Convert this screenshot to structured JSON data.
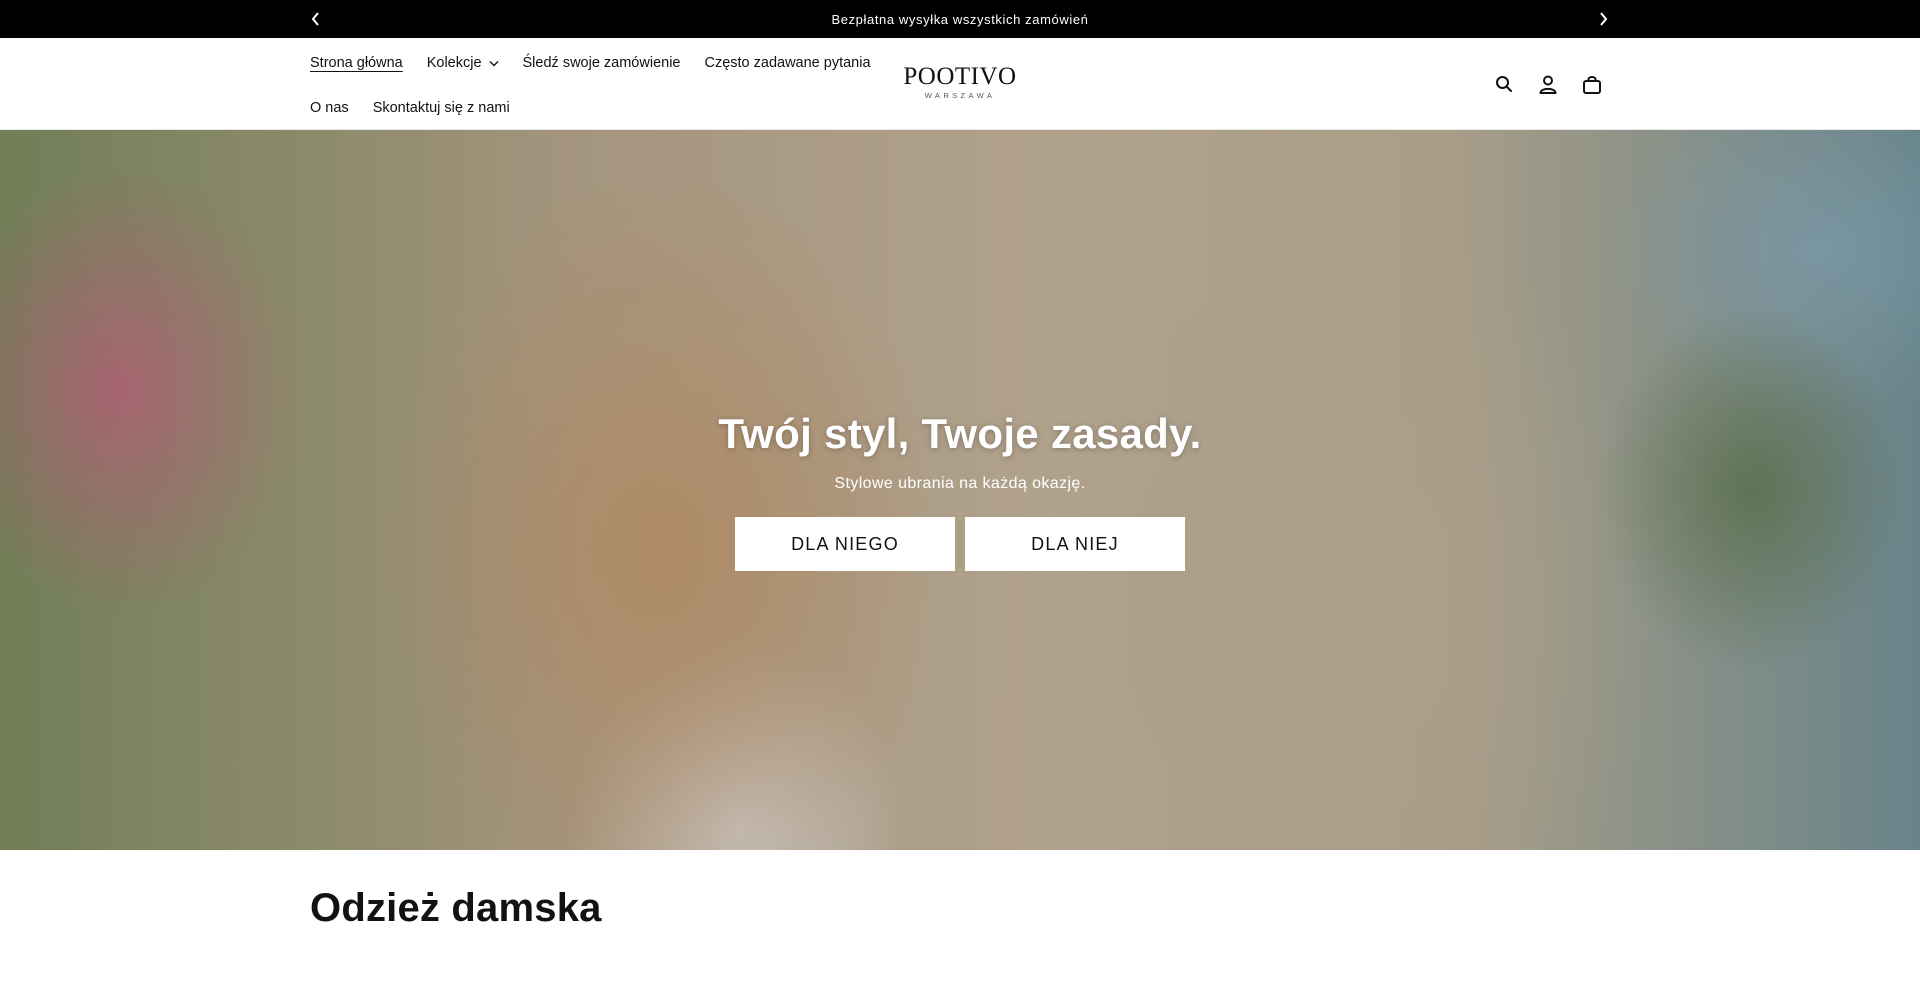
{
  "announcement": {
    "text": "Bezpłatna wysyłka wszystkich zamówień",
    "prev_icon": "chevron-left-icon",
    "next_icon": "chevron-right-icon"
  },
  "nav": {
    "items": [
      {
        "label": "Strona główna",
        "active": true
      },
      {
        "label": "Kolekcje",
        "has_dropdown": true
      },
      {
        "label": "Śledź swoje zamówienie"
      },
      {
        "label": "Często zadawane pytania"
      },
      {
        "label": "O nas"
      },
      {
        "label": "Skontaktuj się z nami"
      }
    ]
  },
  "logo": {
    "name": "POOTIVO",
    "tagline": "WARSZAWA"
  },
  "header_icons": [
    "search-icon",
    "account-icon",
    "cart-icon"
  ],
  "hero": {
    "title": "Twój styl, Twoje zasady.",
    "subtitle": "Stylowe ubrania na każdą okazję.",
    "button_him": "DLA NIEGO",
    "button_her": "DLA NIEJ"
  },
  "section": {
    "title": "Odzież damska"
  },
  "colors": {
    "announcement_bg": "#000000",
    "text": "#121212",
    "button_bg": "#ffffff"
  }
}
